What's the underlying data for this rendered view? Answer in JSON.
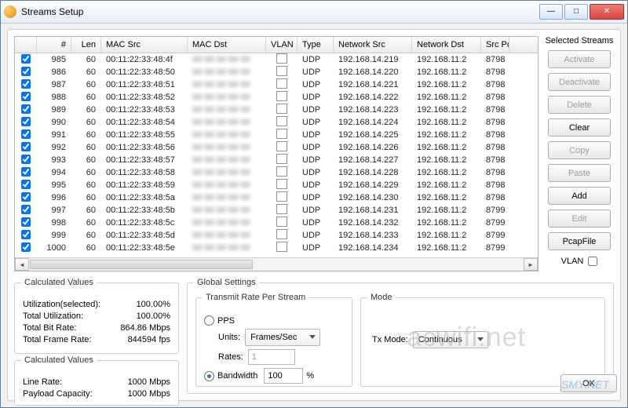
{
  "window": {
    "title": "Streams Setup"
  },
  "table": {
    "headers": {
      "num": "#",
      "len": "Len",
      "msrc": "MAC Src",
      "mdst": "MAC Dst",
      "vlan": "VLAN",
      "type": "Type",
      "nsrc": "Network Src",
      "ndst": "Network Dst",
      "port": "Src Po"
    },
    "rows": [
      {
        "n": "985",
        "len": "60",
        "msrc": "00:11:22:33:48:4f",
        "type": "UDP",
        "nsrc": "192.168.14.219",
        "ndst": "192.168.11.2",
        "port": "8798"
      },
      {
        "n": "986",
        "len": "60",
        "msrc": "00:11:22:33:48:50",
        "type": "UDP",
        "nsrc": "192.168.14.220",
        "ndst": "192.168.11.2",
        "port": "8798"
      },
      {
        "n": "987",
        "len": "60",
        "msrc": "00:11:22:33:48:51",
        "type": "UDP",
        "nsrc": "192.168.14.221",
        "ndst": "192.168.11.2",
        "port": "8798"
      },
      {
        "n": "988",
        "len": "60",
        "msrc": "00:11:22:33:48:52",
        "type": "UDP",
        "nsrc": "192.168.14.222",
        "ndst": "192.168.11.2",
        "port": "8798"
      },
      {
        "n": "989",
        "len": "60",
        "msrc": "00:11:22:33:48:53",
        "type": "UDP",
        "nsrc": "192.168.14.223",
        "ndst": "192.168.11.2",
        "port": "8798"
      },
      {
        "n": "990",
        "len": "60",
        "msrc": "00:11:22:33:48:54",
        "type": "UDP",
        "nsrc": "192.168.14.224",
        "ndst": "192.168.11.2",
        "port": "8798"
      },
      {
        "n": "991",
        "len": "60",
        "msrc": "00:11:22:33:48:55",
        "type": "UDP",
        "nsrc": "192.168.14.225",
        "ndst": "192.168.11.2",
        "port": "8798"
      },
      {
        "n": "992",
        "len": "60",
        "msrc": "00:11:22:33:48:56",
        "type": "UDP",
        "nsrc": "192.168.14.226",
        "ndst": "192.168.11.2",
        "port": "8798"
      },
      {
        "n": "993",
        "len": "60",
        "msrc": "00:11:22:33:48:57",
        "type": "UDP",
        "nsrc": "192.168.14.227",
        "ndst": "192.168.11.2",
        "port": "8798"
      },
      {
        "n": "994",
        "len": "60",
        "msrc": "00:11:22:33:48:58",
        "type": "UDP",
        "nsrc": "192.168.14.228",
        "ndst": "192.168.11.2",
        "port": "8798"
      },
      {
        "n": "995",
        "len": "60",
        "msrc": "00:11:22:33:48:59",
        "type": "UDP",
        "nsrc": "192.168.14.229",
        "ndst": "192.168.11.2",
        "port": "8798"
      },
      {
        "n": "996",
        "len": "60",
        "msrc": "00:11:22:33:48:5a",
        "type": "UDP",
        "nsrc": "192.168.14.230",
        "ndst": "192.168.11.2",
        "port": "8798"
      },
      {
        "n": "997",
        "len": "60",
        "msrc": "00:11:22:33:48:5b",
        "type": "UDP",
        "nsrc": "192.168.14.231",
        "ndst": "192.168.11.2",
        "port": "8799"
      },
      {
        "n": "998",
        "len": "60",
        "msrc": "00:11:22:33:48:5c",
        "type": "UDP",
        "nsrc": "192.168.14.232",
        "ndst": "192.168.11.2",
        "port": "8799"
      },
      {
        "n": "999",
        "len": "60",
        "msrc": "00:11:22:33:48:5d",
        "type": "UDP",
        "nsrc": "192.168.14.233",
        "ndst": "192.168.11.2",
        "port": "8799"
      },
      {
        "n": "1000",
        "len": "60",
        "msrc": "00:11:22:33:48:5e",
        "type": "UDP",
        "nsrc": "192.168.14.234",
        "ndst": "192.168.11.2",
        "port": "8799"
      }
    ],
    "mdst_blur": "00 00 00 00 00"
  },
  "side": {
    "title": "Selected Streams",
    "activate": "Activate",
    "deactivate": "Deactivate",
    "delete": "Delete",
    "clear": "Clear",
    "copy": "Copy",
    "paste": "Paste",
    "add": "Add",
    "edit": "Edit",
    "pcap": "PcapFile",
    "vlan": "VLAN"
  },
  "calc1": {
    "title": "Calculated Values",
    "util_sel_l": "Utilization(selected):",
    "util_sel_v": "100.00%",
    "util_tot_l": "Total Utilization:",
    "util_tot_v": "100.00%",
    "bitrate_l": "Total Bit Rate:",
    "bitrate_v": "864.86 Mbps",
    "framerate_l": "Total Frame Rate:",
    "framerate_v": "844594 fps"
  },
  "calc2": {
    "title": "Calculated Values",
    "line_l": "Line Rate:",
    "line_v": "1000 Mbps",
    "pay_l": "Payload Capacity:",
    "pay_v": "1000 Mbps"
  },
  "global": {
    "title": "Global Settings",
    "rate_title": "Transmit Rate Per Stream",
    "pps": "PPS",
    "units_l": "Units:",
    "units_v": "Frames/Sec",
    "rates_l": "Rates:",
    "rates_v": "1",
    "bw": "Bandwidth",
    "bw_v": "100",
    "bw_u": "%",
    "mode_title": "Mode",
    "txmode_l": "Tx Mode:",
    "txmode_v": "Continuous"
  },
  "ok": "OK",
  "watermark": "acwifi.net",
  "wm2": "SMY.NET"
}
